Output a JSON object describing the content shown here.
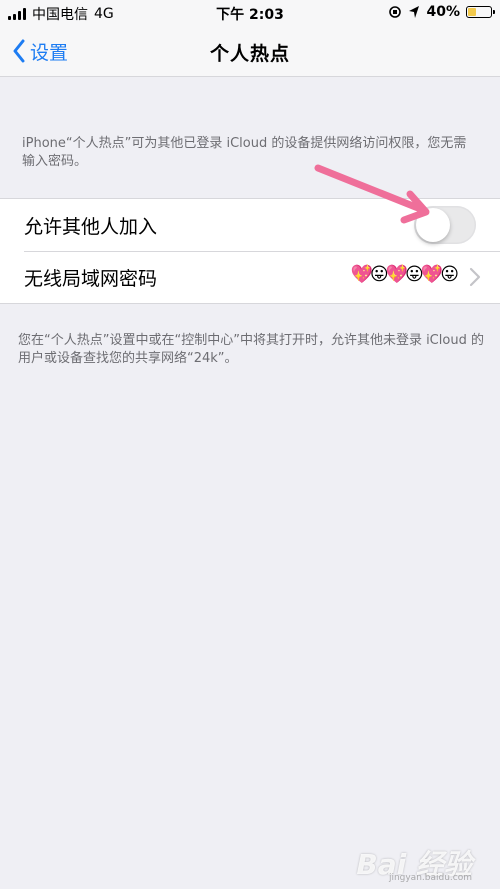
{
  "status_bar": {
    "carrier": "中国电信",
    "network": "4G",
    "time": "下午 2:03",
    "battery_percent": "40%",
    "battery_level": 0.4,
    "battery_color": "#f2c94c"
  },
  "nav": {
    "back_label": "设置",
    "title": "个人热点"
  },
  "hotspot": {
    "description_top": "iPhone“个人热点”可为其他已登录 iCloud 的设备提供网络访问权限，您无需输入密码。",
    "allow_others_label": "允许其他人加入",
    "allow_others_enabled": false,
    "wifi_password_label": "无线局域网密码",
    "wifi_password_value": "💖😛💖😛💖😛",
    "description_bottom": "您在“个人热点”设置中或在“控制中心”中将其打开时，允许其他未登录 iCloud 的用户或设备查找您的共享网络“24k”。"
  },
  "annotation": {
    "arrow_color": "#ef6f9a"
  },
  "watermark": {
    "main": "Bai 经验",
    "sub": "jingyan.baidu.com"
  }
}
